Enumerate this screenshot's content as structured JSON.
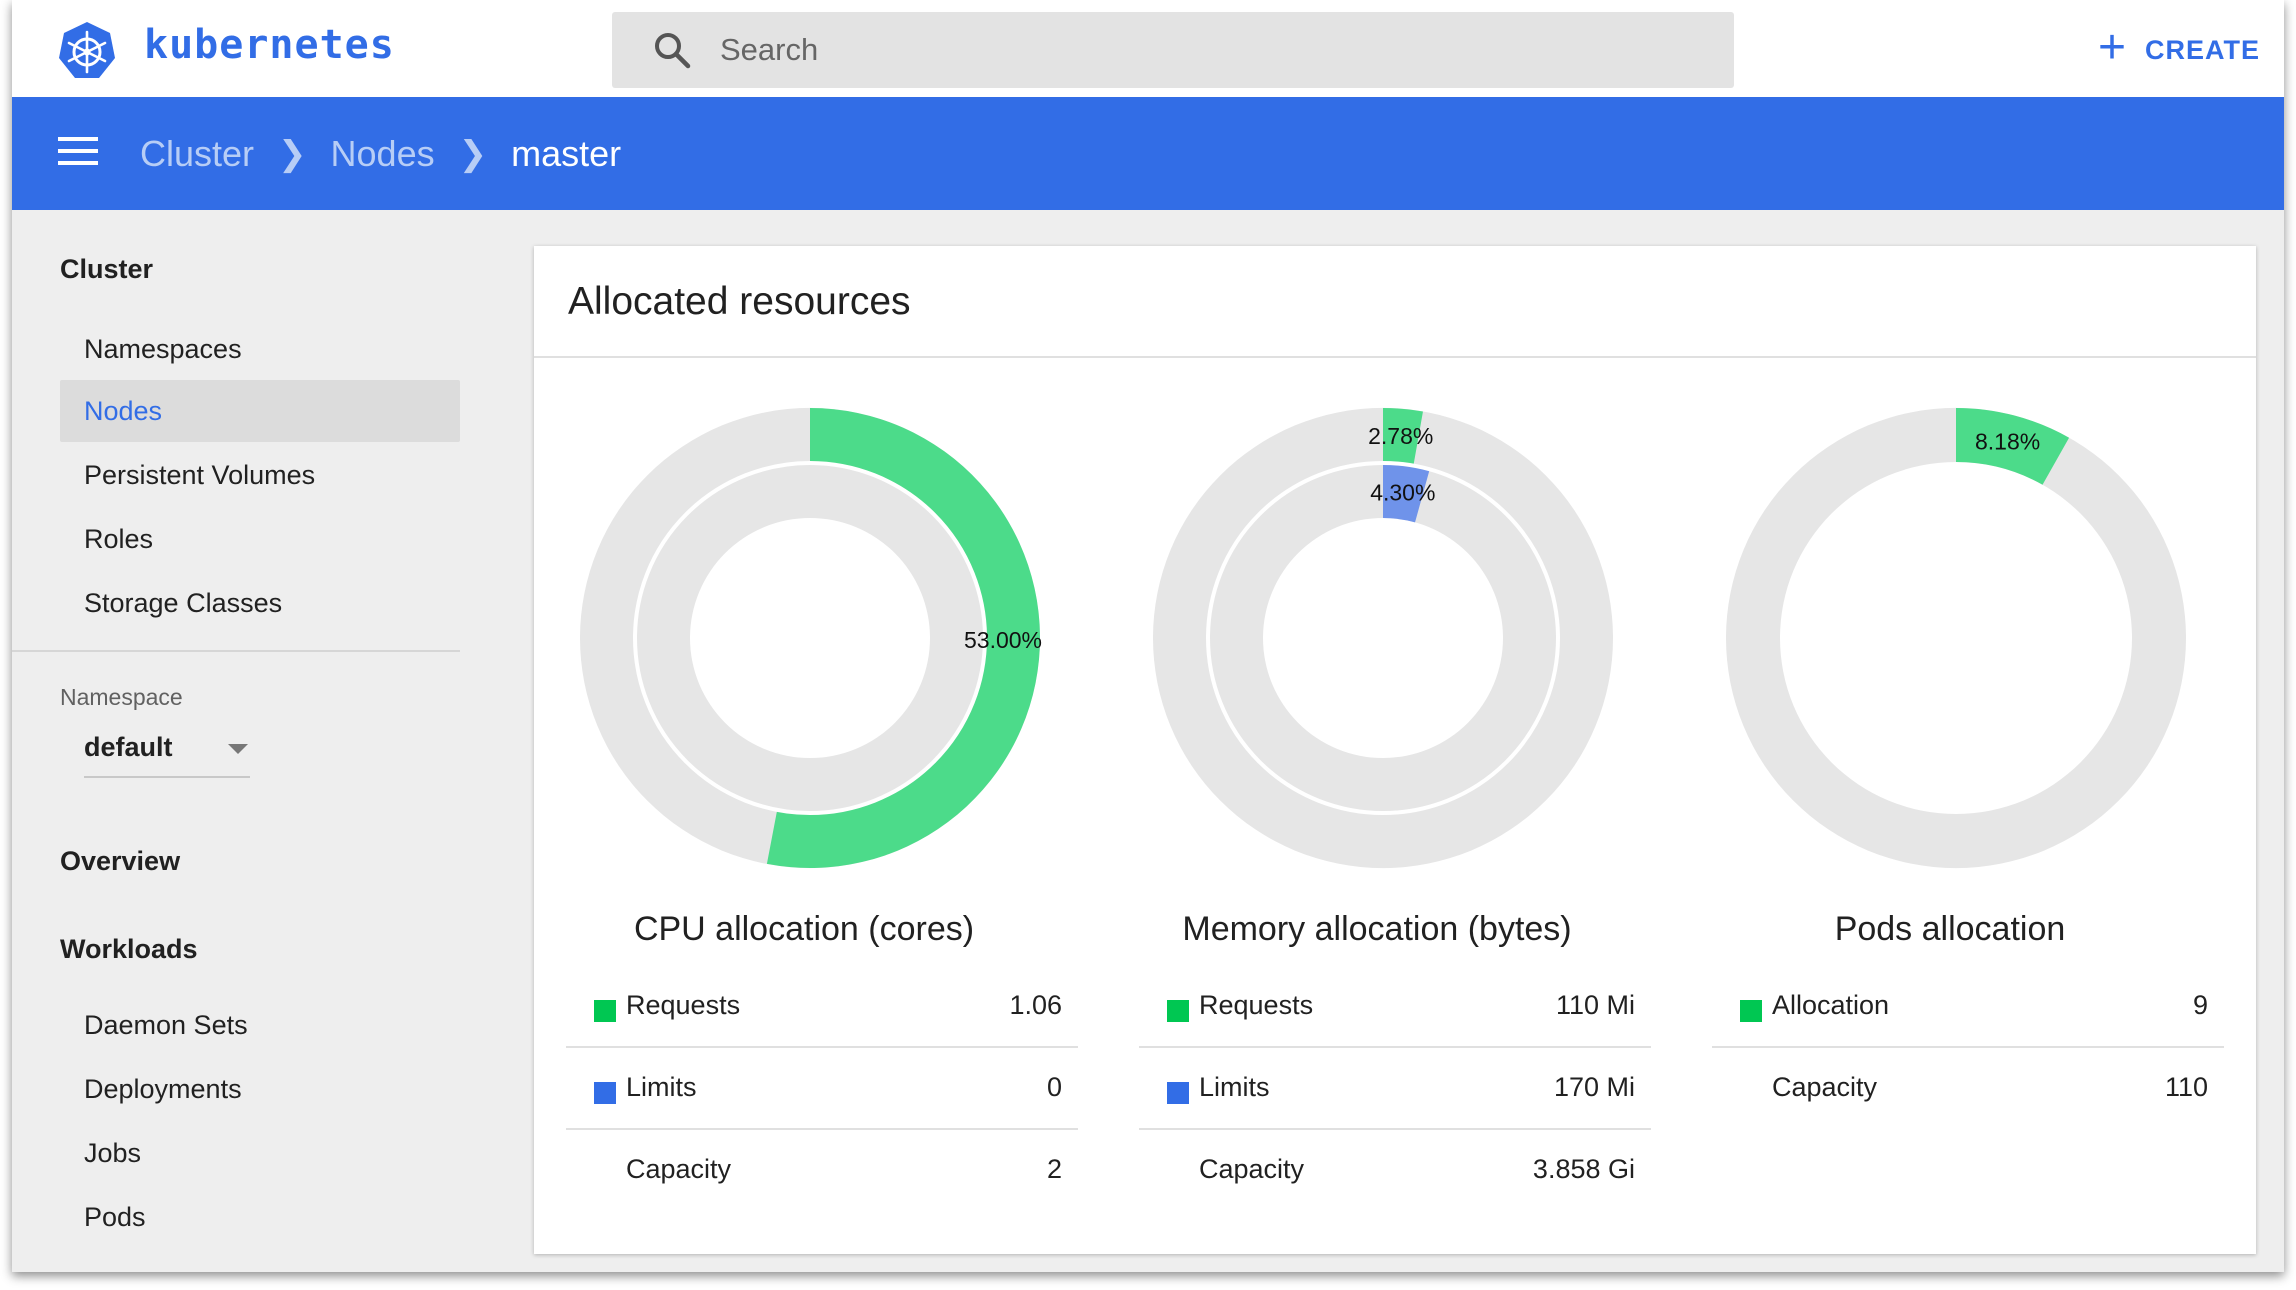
{
  "app": {
    "brand": "kubernetes"
  },
  "search": {
    "placeholder": "Search"
  },
  "header": {
    "create_label": "CREATE"
  },
  "breadcrumb": [
    {
      "label": "Cluster"
    },
    {
      "label": "Nodes"
    },
    {
      "label": "master"
    }
  ],
  "sidebar": {
    "cluster_heading": "Cluster",
    "cluster_items": [
      {
        "label": "Namespaces",
        "active": false
      },
      {
        "label": "Nodes",
        "active": true
      },
      {
        "label": "Persistent Volumes",
        "active": false
      },
      {
        "label": "Roles",
        "active": false
      },
      {
        "label": "Storage Classes",
        "active": false
      }
    ],
    "namespace_label": "Namespace",
    "namespace_value": "default",
    "overview_heading": "Overview",
    "workloads_heading": "Workloads",
    "workload_items": [
      {
        "label": "Daemon Sets"
      },
      {
        "label": "Deployments"
      },
      {
        "label": "Jobs"
      },
      {
        "label": "Pods"
      }
    ]
  },
  "card": {
    "title": "Allocated resources"
  },
  "colors": {
    "requests": "#00c752",
    "limits": "#326de6",
    "track": "#e6e6e6",
    "accent": "#326de6"
  },
  "chart_data": [
    {
      "type": "pie",
      "title": "CPU allocation (cores)",
      "rings": [
        {
          "series": "Requests",
          "percent": 53.0,
          "label": "53.00%"
        },
        {
          "series": "Limits",
          "percent": 0,
          "label": ""
        }
      ],
      "legend": [
        {
          "label": "Requests",
          "value": "1.06",
          "swatch": "requests"
        },
        {
          "label": "Limits",
          "value": "0",
          "swatch": "limits"
        },
        {
          "label": "Capacity",
          "value": "2",
          "swatch": ""
        }
      ]
    },
    {
      "type": "pie",
      "title": "Memory allocation (bytes)",
      "rings": [
        {
          "series": "Requests",
          "percent": 2.78,
          "label": "2.78%"
        },
        {
          "series": "Limits",
          "percent": 4.3,
          "label": "4.30%"
        }
      ],
      "legend": [
        {
          "label": "Requests",
          "value": "110 Mi",
          "swatch": "requests"
        },
        {
          "label": "Limits",
          "value": "170 Mi",
          "swatch": "limits"
        },
        {
          "label": "Capacity",
          "value": "3.858 Gi",
          "swatch": ""
        }
      ]
    },
    {
      "type": "pie",
      "title": "Pods allocation",
      "rings": [
        {
          "series": "Allocation",
          "percent": 8.18,
          "label": "8.18%"
        }
      ],
      "legend": [
        {
          "label": "Allocation",
          "value": "9",
          "swatch": "requests"
        },
        {
          "label": "Capacity",
          "value": "110",
          "swatch": ""
        }
      ]
    }
  ]
}
